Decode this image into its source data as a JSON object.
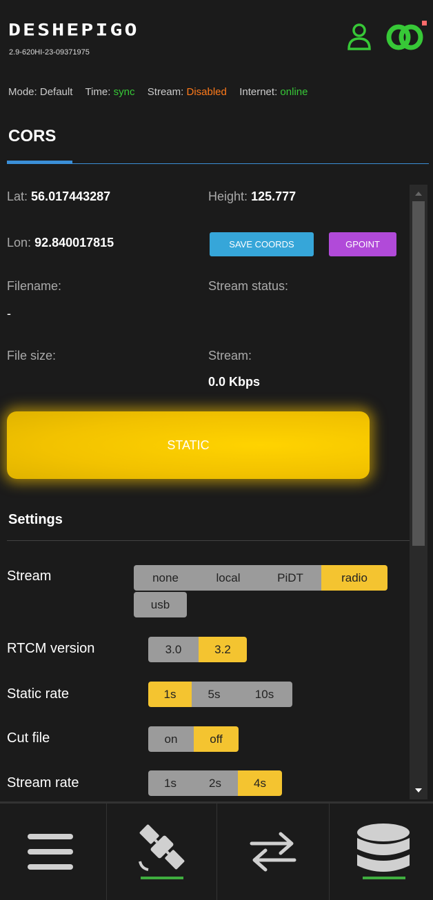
{
  "header": {
    "brand": "DESHEPIGO",
    "serial": "2.9-620HI-23-09371975",
    "status": {
      "mode_label": "Mode:",
      "mode_value": "Default",
      "time_label": "Time:",
      "time_value": "sync",
      "stream_label": "Stream:",
      "stream_value": "Disabled",
      "internet_label": "Internet:",
      "internet_value": "online"
    },
    "icons": [
      "user-icon",
      "link-icon"
    ]
  },
  "page_title": "CORS",
  "info": {
    "lat_label": "Lat:",
    "lat_value": "56.017443287",
    "lon_label": "Lon:",
    "lon_value": "92.840017815",
    "height_label": "Height:",
    "height_value": "125.777",
    "filename_label": "Filename:",
    "filename_value": "-",
    "filesize_label": "File size:",
    "stream_status_label": "Stream status:",
    "stream_label": "Stream:",
    "stream_value": "0.0 Kbps"
  },
  "buttons": {
    "save_coords": "SAVE COORDS",
    "gpoint": "GPOINT",
    "static": "STATIC"
  },
  "settings": {
    "title": "Settings",
    "stream": {
      "label": "Stream",
      "options": [
        "none",
        "local",
        "PiDT",
        "radio",
        "usb"
      ],
      "selected": "radio"
    },
    "rtcm": {
      "label": "RTCM version",
      "options": [
        "3.0",
        "3.2"
      ],
      "selected": "3.2"
    },
    "static_rate": {
      "label": "Static rate",
      "options": [
        "1s",
        "5s",
        "10s"
      ],
      "selected": "1s"
    },
    "cut_file": {
      "label": "Cut file",
      "options": [
        "on",
        "off"
      ],
      "selected": "off"
    },
    "stream_rate": {
      "label": "Stream rate",
      "options": [
        "1s",
        "2s",
        "4s"
      ],
      "selected": "4s"
    }
  },
  "colors": {
    "accent_green": "#37c837",
    "accent_orange": "#ff7a1a",
    "accent_blue": "#3b8fd8",
    "selected_yellow": "#f4c430"
  },
  "bottom_nav": [
    "menu-icon",
    "satellite-icon",
    "transfer-icon",
    "database-icon"
  ]
}
